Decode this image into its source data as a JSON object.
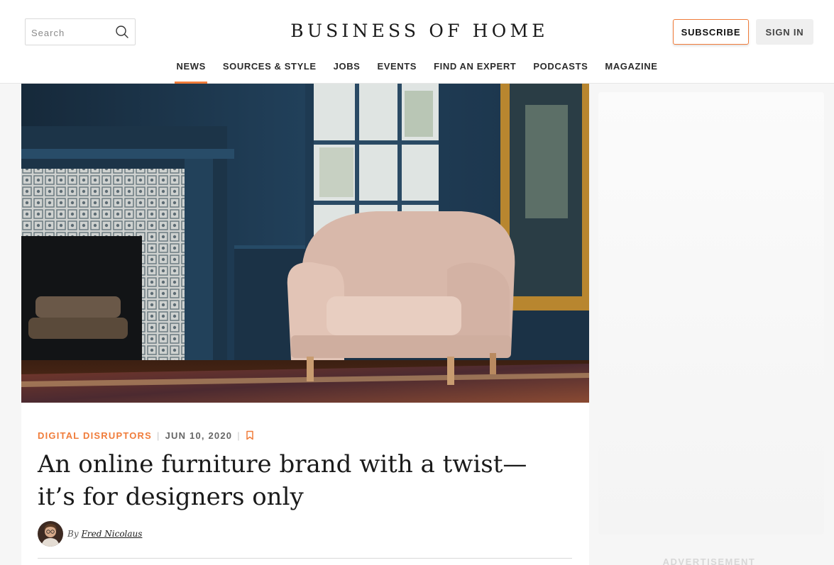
{
  "header": {
    "search": {
      "placeholder": "Search",
      "value": ""
    },
    "logo": "BUSINESS OF HOME",
    "subscribe_label": "SUBSCRIBE",
    "signin_label": "SIGN IN"
  },
  "nav": {
    "items": [
      {
        "label": "NEWS",
        "active": true
      },
      {
        "label": "SOURCES & STYLE",
        "active": false
      },
      {
        "label": "JOBS",
        "active": false
      },
      {
        "label": "EVENTS",
        "active": false
      },
      {
        "label": "FIND AN EXPERT",
        "active": false
      },
      {
        "label": "PODCASTS",
        "active": false
      },
      {
        "label": "MAGAZINE",
        "active": false
      }
    ]
  },
  "article": {
    "category": "DIGITAL DISRUPTORS",
    "separator": "|",
    "date": "JUN 10, 2020",
    "title_line1": "An online furniture brand with a twist—",
    "title_line2": "it’s for designers only",
    "by": "By",
    "author": "Fred Nicolaus"
  },
  "sidebar": {
    "ad_label": "ADVERTISEMENT"
  },
  "colors": {
    "accent": "#f07c3a",
    "text": "#1a1a1a",
    "background": "#f6f6f6",
    "wall_blue": "#1f3a52"
  },
  "icons": {
    "search": "search-icon",
    "bookmark": "bookmark-icon"
  }
}
